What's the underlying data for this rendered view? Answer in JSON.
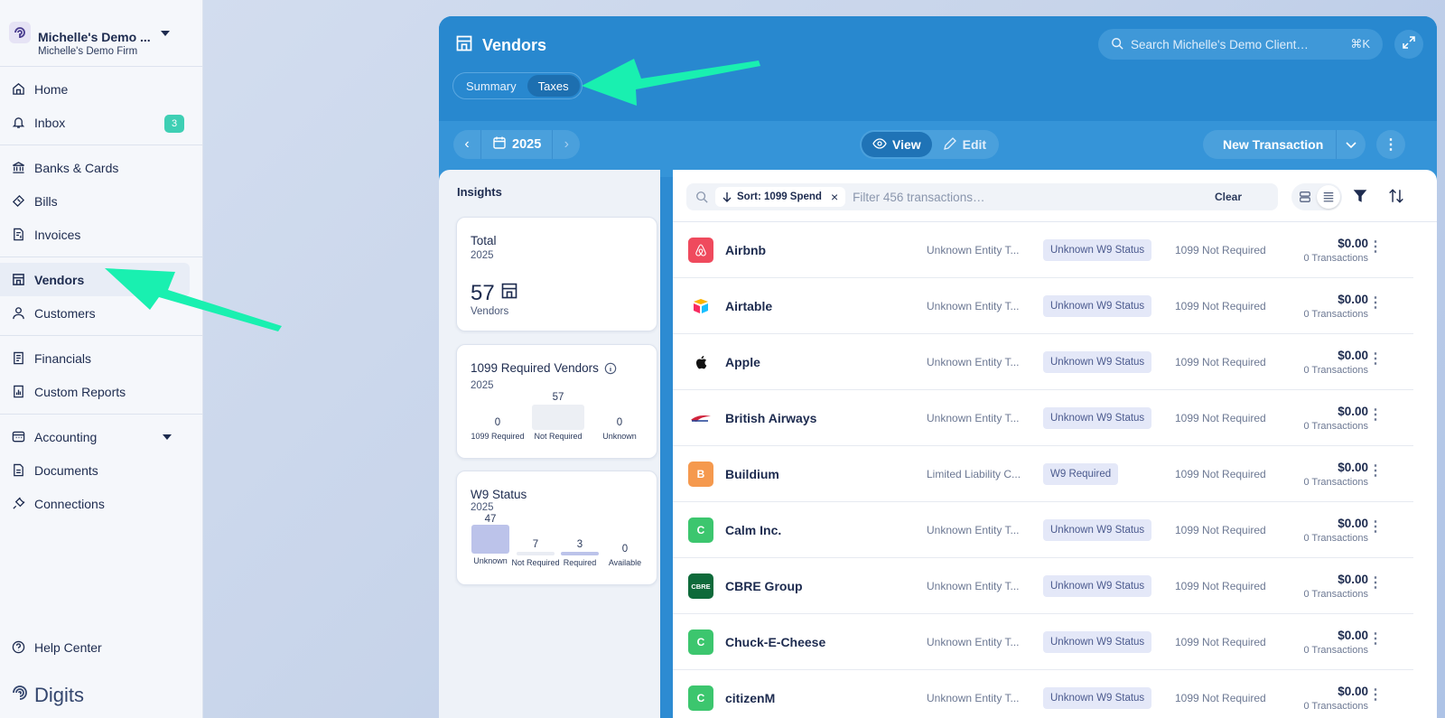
{
  "sidebar": {
    "firm_name": "Michelle's Demo ...",
    "firm_sub": "Michelle's Demo Firm",
    "group1": [
      {
        "label": "Home",
        "icon": "home-icon"
      },
      {
        "label": "Inbox",
        "icon": "bell-icon",
        "badge": "3"
      }
    ],
    "group2": [
      {
        "label": "Banks & Cards",
        "icon": "bank-icon"
      },
      {
        "label": "Bills",
        "icon": "ticket-icon"
      },
      {
        "label": "Invoices",
        "icon": "invoice-icon"
      }
    ],
    "group3": [
      {
        "label": "Vendors",
        "icon": "store-icon",
        "active": true
      },
      {
        "label": "Customers",
        "icon": "person-icon"
      }
    ],
    "group4": [
      {
        "label": "Financials",
        "icon": "report-icon"
      },
      {
        "label": "Custom Reports",
        "icon": "chart-doc-icon"
      }
    ],
    "group5": [
      {
        "label": "Accounting",
        "icon": "ledger-icon"
      },
      {
        "label": "Documents",
        "icon": "document-icon"
      },
      {
        "label": "Connections",
        "icon": "plug-icon"
      }
    ],
    "help": "Help Center",
    "brand": "Digits"
  },
  "header": {
    "title": "Vendors",
    "tabs": [
      "Summary",
      "Taxes"
    ],
    "active_tab": "Taxes",
    "search_placeholder": "Search Michelle's Demo Client…",
    "shortcut": "⌘K"
  },
  "toolbar": {
    "year": "2025",
    "view_label": "View",
    "edit_label": "Edit",
    "new_transaction": "New Transaction"
  },
  "insights": {
    "title": "Insights",
    "total": {
      "title": "Total",
      "year": "2025",
      "value": "57",
      "sub": "Vendors"
    },
    "req1099": {
      "title": "1099 Required Vendors",
      "year": "2025",
      "bars": [
        {
          "value": "0",
          "label": "1099 Required"
        },
        {
          "value": "57",
          "label": "Not Required"
        },
        {
          "value": "0",
          "label": "Unknown"
        }
      ]
    },
    "w9": {
      "title": "W9 Status",
      "year": "2025",
      "bars": [
        {
          "value": "47",
          "label": "Unknown"
        },
        {
          "value": "7",
          "label": "Not Required"
        },
        {
          "value": "3",
          "label": "Required"
        },
        {
          "value": "0",
          "label": "Available"
        }
      ]
    }
  },
  "list": {
    "sort_chip": "Sort: 1099 Spend",
    "filter_placeholder": "Filter 456 transactions…",
    "clear": "Clear",
    "rows": [
      {
        "name": "Airbnb",
        "entity": "Unknown Entity T...",
        "w9": "Unknown W9 Status",
        "req": "1099 Not Required",
        "amount": "$0.00",
        "tx": "0 Transactions",
        "logo_text": "",
        "logo_color": "#ef4a5d"
      },
      {
        "name": "Airtable",
        "entity": "Unknown Entity T...",
        "w9": "Unknown W9 Status",
        "req": "1099 Not Required",
        "amount": "$0.00",
        "tx": "0 Transactions",
        "logo_text": "",
        "logo_color": "#ffffff"
      },
      {
        "name": "Apple",
        "entity": "Unknown Entity T...",
        "w9": "Unknown W9 Status",
        "req": "1099 Not Required",
        "amount": "$0.00",
        "tx": "0 Transactions",
        "logo_text": "",
        "logo_color": "#ffffff"
      },
      {
        "name": "British Airways",
        "entity": "Unknown Entity T...",
        "w9": "Unknown W9 Status",
        "req": "1099 Not Required",
        "amount": "$0.00",
        "tx": "0 Transactions",
        "logo_text": "",
        "logo_color": "#ffffff"
      },
      {
        "name": "Buildium",
        "entity": "Limited Liability C...",
        "w9": "W9 Required",
        "req": "1099 Not Required",
        "amount": "$0.00",
        "tx": "0 Transactions",
        "logo_text": "B",
        "logo_color": "#f5994e"
      },
      {
        "name": "Calm Inc.",
        "entity": "Unknown Entity T...",
        "w9": "Unknown W9 Status",
        "req": "1099 Not Required",
        "amount": "$0.00",
        "tx": "0 Transactions",
        "logo_text": "C",
        "logo_color": "#3cc66e"
      },
      {
        "name": "CBRE Group",
        "entity": "Unknown Entity T...",
        "w9": "Unknown W9 Status",
        "req": "1099 Not Required",
        "amount": "$0.00",
        "tx": "0 Transactions",
        "logo_text": "CBRE",
        "logo_color": "#0e6a3a"
      },
      {
        "name": "Chuck-E-Cheese",
        "entity": "Unknown Entity T...",
        "w9": "Unknown W9 Status",
        "req": "1099 Not Required",
        "amount": "$0.00",
        "tx": "0 Transactions",
        "logo_text": "C",
        "logo_color": "#3cc66e"
      },
      {
        "name": "citizenM",
        "entity": "Unknown Entity T...",
        "w9": "Unknown W9 Status",
        "req": "1099 Not Required",
        "amount": "$0.00",
        "tx": "0 Transactions",
        "logo_text": "C",
        "logo_color": "#3cc66e"
      }
    ]
  },
  "colors": {
    "accent": "#2888cf",
    "highlight_arrow": "#19f0b0",
    "badge": "#3ecfb4"
  }
}
